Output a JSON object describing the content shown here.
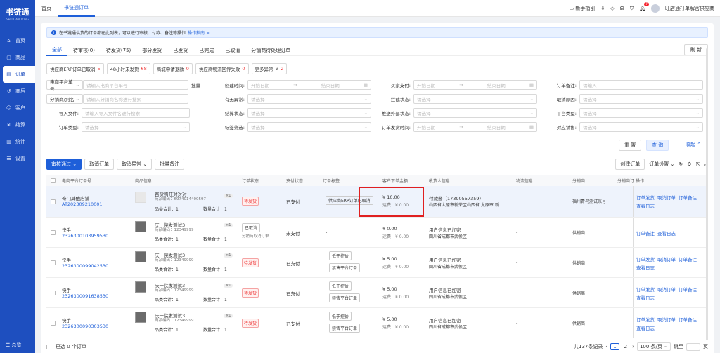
{
  "brand": {
    "title": "书链通",
    "subtitle": "SHU LIAN TONG"
  },
  "sidebar": {
    "items": [
      {
        "label": "首页"
      },
      {
        "label": "商品"
      },
      {
        "label": "订单"
      },
      {
        "label": "商后"
      },
      {
        "label": "客户"
      },
      {
        "label": "结算"
      },
      {
        "label": "统计"
      },
      {
        "label": "设置"
      }
    ],
    "footer": "总览"
  },
  "topbar": {
    "tabs": [
      "首页",
      "书链通订单"
    ],
    "guide": "新手指引",
    "bell_count": "7",
    "user": "旺店通打单解密供应商"
  },
  "notice": {
    "text": "在书链通供货的订单都在此列表，可以进行审核、付款、备注等操作",
    "link": "操作指南 >"
  },
  "tabs": [
    "全部",
    "待审核(0)",
    "待发货(75)",
    "部分发货",
    "已发货",
    "已完成",
    "已取消",
    "分销商待处理订单"
  ],
  "refresh": "刷 新",
  "quick_filters": [
    {
      "label": "供应商ERP订单已取消",
      "count": "5"
    },
    {
      "label": "48小时未发货",
      "count": "68"
    },
    {
      "label": "商城申请退款",
      "count": "0"
    },
    {
      "label": "供应商物流回传失败",
      "count": "0"
    },
    {
      "label": "更多异常",
      "count": "2"
    }
  ],
  "form": {
    "r1": {
      "sel": "电商平台单号",
      "ph": "请输入电商平台单号",
      "batch": "批量",
      "l2": "创建时间:",
      "start": "开始日期",
      "end": "结束日期",
      "l3": "买家支付:",
      "start3": "开始日期",
      "end3": "结束日期",
      "l4": "订单备注:",
      "ph4": "请输入"
    },
    "r2": {
      "sel": "分销商/别名",
      "ph": "请输入分销商名称进行搜索",
      "l2": "有无异常:",
      "ph2": "请选择",
      "l3": "拦截状态:",
      "ph3": "请选择",
      "l4": "取消原因:",
      "ph4": "请选择"
    },
    "r3": {
      "l1": "导入文件:",
      "ph": "请输入导入文件名进行搜索",
      "l2": "结算状态:",
      "ph2": "请选择",
      "l3": "推送外部状态:",
      "ph3": "请选择",
      "l4": "平台类型:",
      "ph4": "请选择"
    },
    "r4": {
      "l1": "订单类型:",
      "ph": "请选择",
      "l2": "标签筛选:",
      "ph2": "请选择",
      "l3": "订单发货时间:",
      "start3": "开始日期",
      "end3": "结束日期",
      "l4": "对应销售:",
      "ph4": "请选择"
    }
  },
  "buttons": {
    "reset": "重 置",
    "query": "查 询",
    "collapse": "收起"
  },
  "actions": {
    "audit": "审核通过",
    "cancel": "取消订单",
    "cancel_ex": "取消异常",
    "batch_note": "批量备注",
    "create": "创建订单",
    "settings": "订单设置"
  },
  "table": {
    "headers": [
      "电商平台订单号",
      "商品信息",
      "订单状态",
      "支付状态",
      "订单标签",
      "客户下单金额",
      "收货人信息",
      "物流信息",
      "分销商",
      "分销商订...",
      "操作"
    ],
    "rows": [
      {
        "shop": "奇门其他店铺",
        "order": "AT202309210001",
        "product": "百货购旺对对对",
        "code": "商品编码：6974014400597",
        "qty": "×1",
        "kinds": "品类合计：1",
        "qtysum": "数量合计：1",
        "status": "待发货",
        "pay": "已支付",
        "tag": "供应商ERP订单已取消",
        "amount": "¥ 10.00",
        "freight": "运费：¥ 0.00",
        "recv1": "付款酱（17390557359）",
        "recv2": "山西省太原市新荣区山西省 太原市 新...",
        "logi": "-",
        "dist": "福州青鸟测试账号",
        "dist2": "",
        "ops": [
          "订单发货",
          "取消订单",
          "订单备注",
          "查看日志"
        ]
      },
      {
        "shop": "快手",
        "order": "2326300103959530",
        "product": "庆一院发测试3",
        "code": "商品编码：12349999",
        "qty": "×1",
        "kinds": "品类合计：1",
        "qtysum": "数量合计：1",
        "status": "已取消",
        "status2": "分销商取消订单",
        "pay": "未支付",
        "tag": "-",
        "amount": "¥ 0.00",
        "freight": "运费：¥ 0.00",
        "recv1": "用户信息已加密",
        "recv2": "四川省成都市武侯区",
        "logi": "-",
        "dist": "供销商",
        "dist2": "",
        "ops": [
          "订单备注",
          "查看日志"
        ]
      },
      {
        "shop": "快手",
        "order": "2326300099042530",
        "product": "庆一院发测试3",
        "code": "商品编码：12349999",
        "qty": "×1",
        "kinds": "品类合计：1",
        "qtysum": "数量合计：1",
        "status": "待发货",
        "pay": "已支付",
        "tag1": "低于控价",
        "tag2": "禁售平台订单",
        "amount": "¥ 5.00",
        "freight": "运费：¥ 0.00",
        "recv1": "用户信息已加密",
        "recv2": "四川省成都市武侯区",
        "logi": "-",
        "dist": "供销商",
        "dist2": "",
        "ops": [
          "订单发货",
          "取消订单",
          "订单备注",
          "查看日志"
        ]
      },
      {
        "shop": "快手",
        "order": "2326300091638530",
        "product": "庆一院发测试3",
        "code": "商品编码：12349999",
        "qty": "×1",
        "kinds": "品类合计：1",
        "qtysum": "数量合计：1",
        "status": "待发货",
        "pay": "已支付",
        "tag1": "低于控价",
        "tag2": "禁售平台订单",
        "amount": "¥ 5.00",
        "freight": "运费：¥ 0.00",
        "recv1": "用户信息已加密",
        "recv2": "四川省成都市武侯区",
        "logi": "-",
        "dist": "供销商",
        "dist2": "",
        "ops": [
          "订单发货",
          "取消订单",
          "订单备注",
          "查看日志"
        ]
      },
      {
        "shop": "快手",
        "order": "2326300090303530",
        "product": "庆一院发测试3",
        "code": "商品编码：12349999",
        "qty": "×1",
        "kinds": "品类合计：1",
        "qtysum": "数量合计：1",
        "status": "待发货",
        "pay": "已支付",
        "tag1": "低于控价",
        "tag2": "禁售平台订单",
        "amount": "¥ 5.00",
        "freight": "运费：¥ 0.00",
        "recv1": "用户信息已加密",
        "recv2": "四川省成都市武侯区",
        "logi": "-",
        "dist": "供销商",
        "dist2": "",
        "ops": [
          "订单发货",
          "取消订单",
          "订单备注",
          "查看日志"
        ]
      }
    ]
  },
  "footer": {
    "selected": "已选 0 个订单",
    "total": "共137条记录",
    "page1": "1",
    "page2": "2",
    "size": "100 条/页",
    "jump": "跳至",
    "unit": "页"
  }
}
